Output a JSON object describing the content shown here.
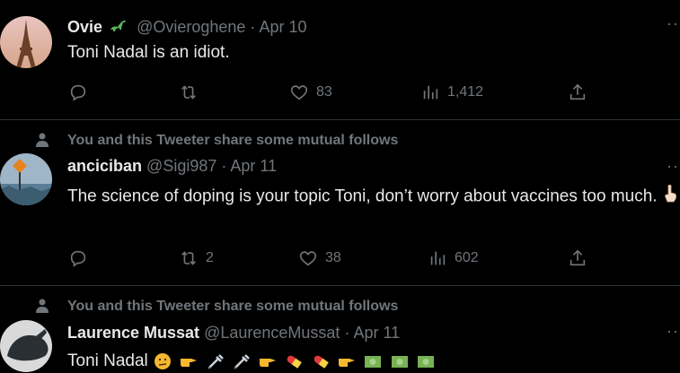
{
  "social_context": "You and this Tweeter share some mutual follows",
  "tweets": [
    {
      "name": "Ovie",
      "handle": "@Ovieroghene",
      "sep": "·",
      "date": "Apr 10",
      "text": "Toni Nadal is an idiot.",
      "replies": "",
      "retweets": "",
      "likes": "83",
      "views": "1,412",
      "more": "··"
    },
    {
      "name": "anciciban",
      "handle": "@Sigi987",
      "sep": "·",
      "date": "Apr 11",
      "text": "The science of doping is your topic Toni, don’t worry about vaccines too much.",
      "replies": "",
      "retweets": "2",
      "likes": "38",
      "views": "602",
      "more": "··"
    },
    {
      "name": "Laurence Mussat",
      "handle": "@LaurenceMussat",
      "sep": "·",
      "date": "Apr 11",
      "text": "Toni Nadal",
      "more": "··"
    }
  ],
  "icons": {
    "reply": "reply-icon",
    "retweet": "retweet-icon",
    "like": "heart-icon",
    "views": "views-icon",
    "share": "share-icon"
  },
  "colors": {
    "background": "#000000",
    "text": "#e7e9ea",
    "muted": "#71767b",
    "divider": "#2f3336"
  }
}
